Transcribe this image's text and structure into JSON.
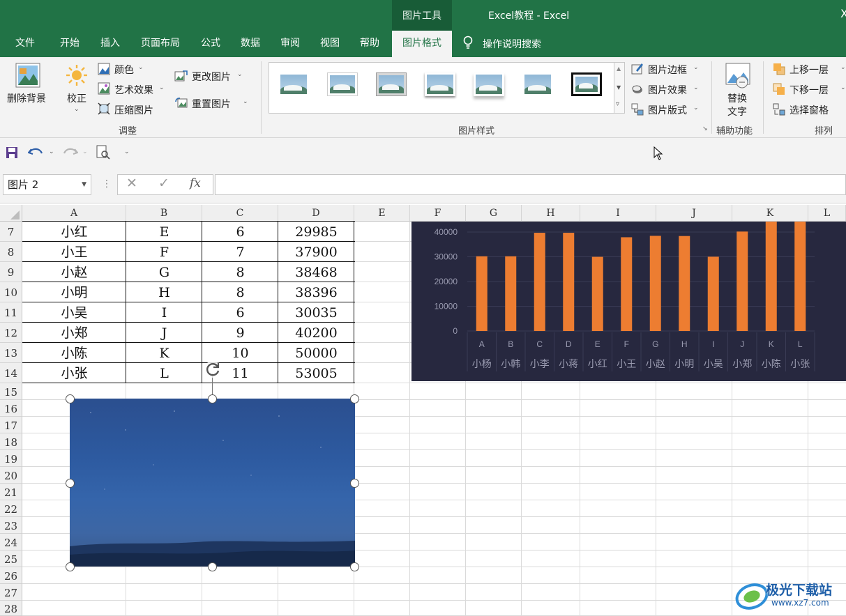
{
  "window": {
    "context_group": "图片工具",
    "title": "Excel教程  -  Excel",
    "close_glyph": "X"
  },
  "tabs": [
    {
      "label": "文件"
    },
    {
      "label": "开始"
    },
    {
      "label": "插入"
    },
    {
      "label": "页面布局"
    },
    {
      "label": "公式"
    },
    {
      "label": "数据"
    },
    {
      "label": "审阅"
    },
    {
      "label": "视图"
    },
    {
      "label": "帮助"
    },
    {
      "label": "图片格式",
      "active": true
    }
  ],
  "tell_me": "操作说明搜索",
  "ribbon": {
    "adjust": {
      "remove_bg": "删除背景",
      "corrections": "校正",
      "color": "颜色",
      "artistic": "艺术效果",
      "compress": "压缩图片",
      "change_picture": "更改图片",
      "reset_picture": "重置图片",
      "group_label": "调整"
    },
    "styles": {
      "border": "图片边框",
      "effects": "图片效果",
      "layout": "图片版式",
      "group_label": "图片样式"
    },
    "accessibility": {
      "alt_text_line1": "替换",
      "alt_text_line2": "文字",
      "group_label": "辅助功能"
    },
    "arrange": {
      "bring_forward": "上移一层",
      "send_backward": "下移一层",
      "selection_pane": "选择窗格",
      "group_label": "排列"
    }
  },
  "formula_bar": {
    "name_box": "图片 2",
    "fx": "fx",
    "formula": ""
  },
  "sheet": {
    "columns": [
      "A",
      "B",
      "C",
      "D",
      "E",
      "F",
      "G",
      "H",
      "I",
      "J",
      "K",
      "L"
    ],
    "rows": [
      "7",
      "8",
      "9",
      "10",
      "11",
      "12",
      "13",
      "14",
      "15",
      "16",
      "17",
      "18",
      "19",
      "20",
      "21",
      "22",
      "23",
      "24",
      "25",
      "26",
      "27",
      "28"
    ],
    "table": [
      [
        "小红",
        "E",
        "6",
        "29985"
      ],
      [
        "小王",
        "F",
        "7",
        "37900"
      ],
      [
        "小赵",
        "G",
        "8",
        "38468"
      ],
      [
        "小明",
        "H",
        "8",
        "38396"
      ],
      [
        "小吴",
        "I",
        "6",
        "30035"
      ],
      [
        "小郑",
        "J",
        "9",
        "40200"
      ],
      [
        "小陈",
        "K",
        "10",
        "50000"
      ],
      [
        "小张",
        "L",
        "11",
        "53005"
      ]
    ]
  },
  "chart_data": {
    "type": "bar",
    "categories": [
      "A",
      "B",
      "C",
      "D",
      "E",
      "F",
      "G",
      "H",
      "I",
      "J",
      "K",
      "L"
    ],
    "category_labels_2": [
      "小杨",
      "小韩",
      "小李",
      "小蒋",
      "小红",
      "小王",
      "小赵",
      "小明",
      "小吴",
      "小郑",
      "小陈",
      "小张"
    ],
    "values": [
      30200,
      30200,
      39700,
      39700,
      29985,
      37900,
      38468,
      38396,
      30035,
      40200,
      50000,
      53005
    ],
    "yticks": [
      "40000",
      "30000",
      "20000",
      "10000",
      "0"
    ],
    "ylim": [
      0,
      40000
    ],
    "grid": true,
    "bar_color": "#ed7d31",
    "background": "#27283f"
  },
  "watermark": {
    "name": "极光下载站",
    "url": "www.xz7.com"
  },
  "colors": {
    "excel_green": "#217346",
    "ribbon_bg": "#f3f3f3"
  }
}
